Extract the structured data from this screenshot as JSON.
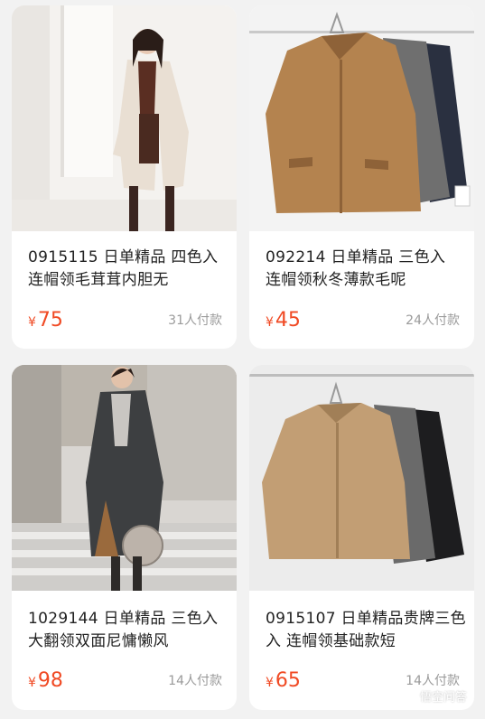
{
  "products": [
    {
      "title": "0915115 日单精品 四色入 连帽领毛茸茸内胆无",
      "currency": "¥",
      "price": "75",
      "paid": "31人付款"
    },
    {
      "title": "092214 日单精品 三色入 连帽领秋冬薄款毛呢",
      "currency": "¥",
      "price": "45",
      "paid": "24人付款"
    },
    {
      "title": "1029144 日单精品 三色入 大翻领双面尼慵懒风",
      "currency": "¥",
      "price": "98",
      "paid": "14人付款"
    },
    {
      "title": "0915107 日单精品贵牌三色入 连帽领基础款短",
      "currency": "¥",
      "price": "65",
      "paid": "14人付款"
    }
  ],
  "watermark": {
    "text": "悟空问答",
    "icon": "speech-bubble-icon"
  },
  "colors": {
    "price": "#f04a24",
    "paid": "#9a9a9a",
    "background": "#f2f2f2"
  }
}
